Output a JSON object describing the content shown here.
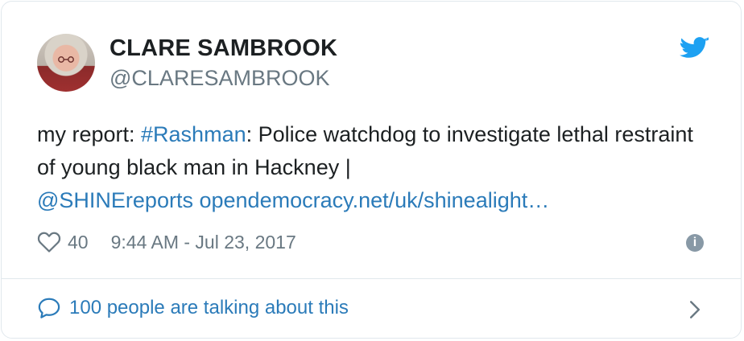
{
  "author": {
    "name": "CLARE SAMBROOK",
    "handle": "@CLARESAMBROOK"
  },
  "tweet": {
    "text_parts": [
      {
        "text": "my report: ",
        "type": "text"
      },
      {
        "text": "#Rashman",
        "type": "link"
      },
      {
        "text": ": Police watchdog to investigate lethal restraint of young black man in Hackney | ",
        "type": "text"
      },
      {
        "text": "@SHINEreports",
        "type": "link"
      },
      {
        "text": " ",
        "type": "text"
      },
      {
        "text": "opendemocracy.net/uk/shinealight…",
        "type": "link"
      }
    ]
  },
  "meta": {
    "likes": "40",
    "timestamp": "9:44 AM - Jul 23, 2017",
    "info_glyph": "i"
  },
  "footer": {
    "conversation_label": "100 people are talking about this"
  },
  "icons": {
    "brand": "twitter-bird-icon",
    "like": "heart-icon",
    "info": "info-icon",
    "conversation": "speech-bubble-icon",
    "chevron": "chevron-right-icon"
  },
  "colors": {
    "link": "#2b7bb9",
    "twitter_blue": "#1da1f2",
    "secondary_text": "#697882",
    "border": "#e1e8ed"
  }
}
